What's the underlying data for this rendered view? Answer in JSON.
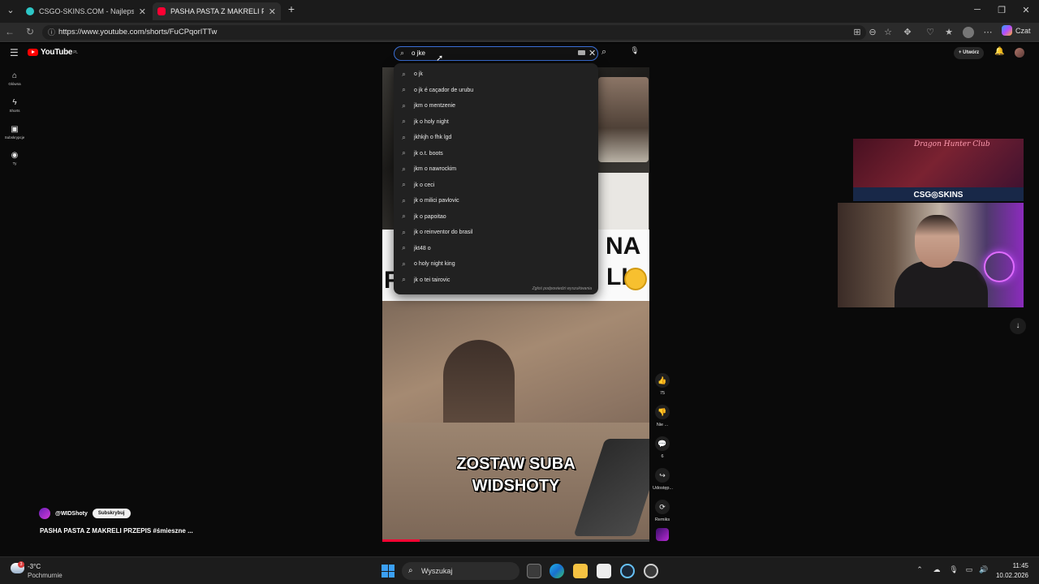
{
  "browser": {
    "tabs": [
      {
        "title": "CSGO-SKINS.COM - Najlepsze Sk",
        "active": false,
        "favicon_color": "#2dc7c7"
      },
      {
        "title": "PASHA PASTA Z MAKRELI PRZEPIS",
        "active": true,
        "favicon_color": "#ff0033"
      }
    ],
    "url": "https://www.youtube.com/shorts/FuCPqorITTw",
    "copilot_label": "Czat"
  },
  "youtube": {
    "logo_text": "YouTube",
    "logo_country": "PL",
    "sidebar": [
      {
        "label": "Główna",
        "icon": "home-icon",
        "glyph": "⌂"
      },
      {
        "label": "Shorts",
        "icon": "shorts-icon",
        "glyph": "ϟ"
      },
      {
        "label": "Subskrypcje",
        "icon": "subscriptions-icon",
        "glyph": "▣"
      },
      {
        "label": "Ty",
        "icon": "you-icon",
        "glyph": "◉"
      }
    ],
    "search": {
      "query": "o jke",
      "suggestions": [
        "o jk",
        "o jk é caçador de urubu",
        "jkm o mentzenie",
        "jk o holy night",
        "jkhkjh o fhk lgd",
        "jk o.t. boots",
        "jkm o nawrockim",
        "jk o ceci",
        "jk o milici pavlovic",
        "jk o papoitao",
        "jk o reinventor do brasil",
        "jkt48 o",
        "o holy night king",
        "jk o tei tairovic"
      ],
      "footer": "Zgłoś podpowiedzi wyszukiwania"
    },
    "create_label": "Utwórz",
    "video": {
      "caption_line1": "NA",
      "caption_line2": "LI",
      "caption_left": "F",
      "overlay_text_1": "ZOSTAW SUBA",
      "overlay_text_2": "WIDSHOTY",
      "progress": 0.14
    },
    "actions": [
      {
        "label": "75",
        "icon": "like-icon",
        "glyph": "👍"
      },
      {
        "label": "Nie ...",
        "icon": "dislike-icon",
        "glyph": "👎"
      },
      {
        "label": "6",
        "icon": "comment-icon",
        "glyph": "💬"
      },
      {
        "label": "Udostęp...",
        "icon": "share-icon",
        "glyph": "↪"
      },
      {
        "label": "Remiks",
        "icon": "remix-icon",
        "glyph": "⟳"
      }
    ],
    "channel": {
      "name": "@WIDShoty",
      "subscribe_label": "Subskrybuj",
      "title": "PASHA PASTA Z MAKRELI PRZEPIS #śmieszne ..."
    }
  },
  "overlay": {
    "banner_title": "Dragon Hunter Club",
    "banner_brand": "CSG◎SKINS"
  },
  "taskbar": {
    "temperature": "-3°C",
    "condition": "Pochmurnie",
    "weather_badge": "3",
    "search_label": "Wyszukaj",
    "time": "11:45",
    "date": "10.02.2026"
  }
}
